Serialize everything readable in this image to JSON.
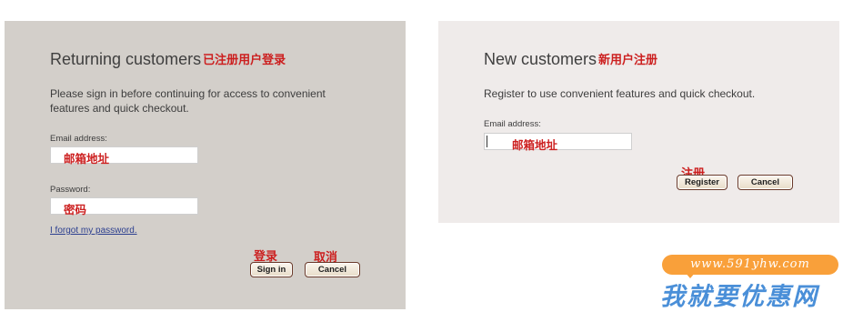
{
  "returning": {
    "title": "Returning customers",
    "title_cn": "已注册用户登录",
    "description": "Please sign in before continuing for access to convenient features and quick checkout.",
    "email_label": "Email address:",
    "email_placeholder_cn": "邮箱地址",
    "password_label": "Password:",
    "password_placeholder_cn": "密码",
    "forgot_link": "I forgot my password.",
    "signin_cn": "登录",
    "cancel_cn": "取消",
    "signin_button": "Sign in",
    "cancel_button": "Cancel"
  },
  "new": {
    "title": "New customers",
    "title_cn": "新用户注册",
    "description": "Register to use convenient features and quick checkout.",
    "email_label": "Email address:",
    "email_placeholder_cn": "邮箱地址",
    "register_cn": "注册",
    "register_button": "Register",
    "cancel_button": "Cancel"
  },
  "watermark": {
    "url": "www.591yhw.com",
    "text": "我就要优惠网"
  },
  "colors": {
    "left_panel": "#d3cfca",
    "right_panel": "#efebea",
    "annotation_red": "#cc1f1f",
    "link_blue": "#2c3f8f",
    "watermark_orange": "#f9a03a",
    "watermark_blue": "#4a8fd8"
  }
}
